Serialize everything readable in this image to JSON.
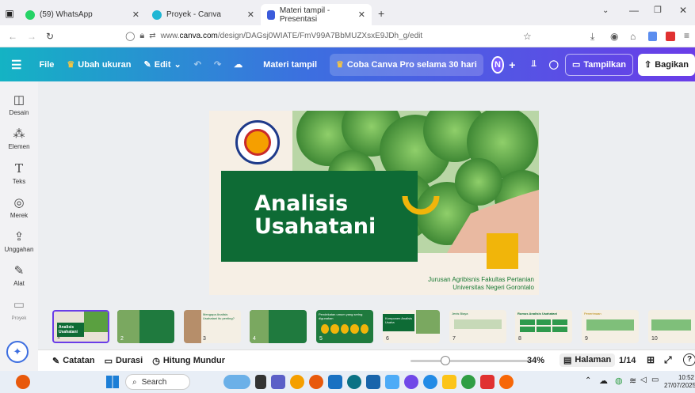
{
  "browser": {
    "tabs": [
      {
        "label": "(59) WhatsApp",
        "icon": "whatsapp-icon",
        "color": "#25d366"
      },
      {
        "label": "Proyek - Canva",
        "icon": "canva-icon",
        "color": "#1fb6d4"
      },
      {
        "label": "Materi tampil - Presentasi",
        "icon": "canva-presentation-icon",
        "color": "#3b5bdb"
      }
    ],
    "new_tab": "+",
    "url_prefix": "www.",
    "url_domain": "canva.com",
    "url_path": "/design/DAGsj0WIATE/FmV99A7BbMUZXsxE9JDh_g/edit"
  },
  "toolbar": {
    "menu": "☰",
    "file": "File",
    "resize": "Ubah ukuran",
    "edit": "Edit",
    "title": "Materi tampil",
    "pro": "Coba Canva Pro selama 30 hari",
    "avatar": "N",
    "present": "Tampilkan",
    "share": "Bagikan"
  },
  "sidebar": {
    "items": [
      {
        "label": "Desain",
        "icon": "design-icon",
        "glyph": "◫"
      },
      {
        "label": "Elemen",
        "icon": "elements-icon",
        "glyph": "⁂"
      },
      {
        "label": "Teks",
        "icon": "text-icon",
        "glyph": "T"
      },
      {
        "label": "Merek",
        "icon": "brand-icon",
        "glyph": "◎"
      },
      {
        "label": "Unggahan",
        "icon": "upload-icon",
        "glyph": "⇪"
      },
      {
        "label": "Alat",
        "icon": "tools-icon",
        "glyph": "✎"
      },
      {
        "label": "Proyek",
        "icon": "projects-icon",
        "glyph": "▭"
      }
    ]
  },
  "slide": {
    "title_line1": "Analisis",
    "title_line2": "Usahatani",
    "footer_line1": "Jurusan Agribisnis Fakultas Pertanian",
    "footer_line2": "Universitas Negeri Gorontalo",
    "colors": {
      "green": "#0e6b35",
      "yellow": "#f1b50a",
      "cream": "#f6efe5"
    }
  },
  "thumbnails": [
    {
      "num": "1",
      "title": "Analisis Usahatani"
    },
    {
      "num": "2",
      "title": ""
    },
    {
      "num": "3",
      "title": "Mengapa Analisis Usahatani itu penting?"
    },
    {
      "num": "4",
      "title": ""
    },
    {
      "num": "5",
      "title": "Pendekatan umum yang sering digunakan"
    },
    {
      "num": "6",
      "title": "Komponen Analisis Usaha"
    },
    {
      "num": "7",
      "title": "Jenis Biaya"
    },
    {
      "num": "8",
      "title": "Rumus Analisis Usahatani"
    },
    {
      "num": "9",
      "title": "Penerimaan"
    },
    {
      "num": "10",
      "title": ""
    }
  ],
  "bottombar": {
    "notes": "Catatan",
    "duration": "Durasi",
    "countdown": "Hitung Mundur",
    "zoom": "34%",
    "pages_label": "Halaman",
    "page_count": "1/14",
    "help": "?"
  },
  "taskbar": {
    "search": "Search",
    "time": "10:52",
    "date": "27/07/2025"
  }
}
